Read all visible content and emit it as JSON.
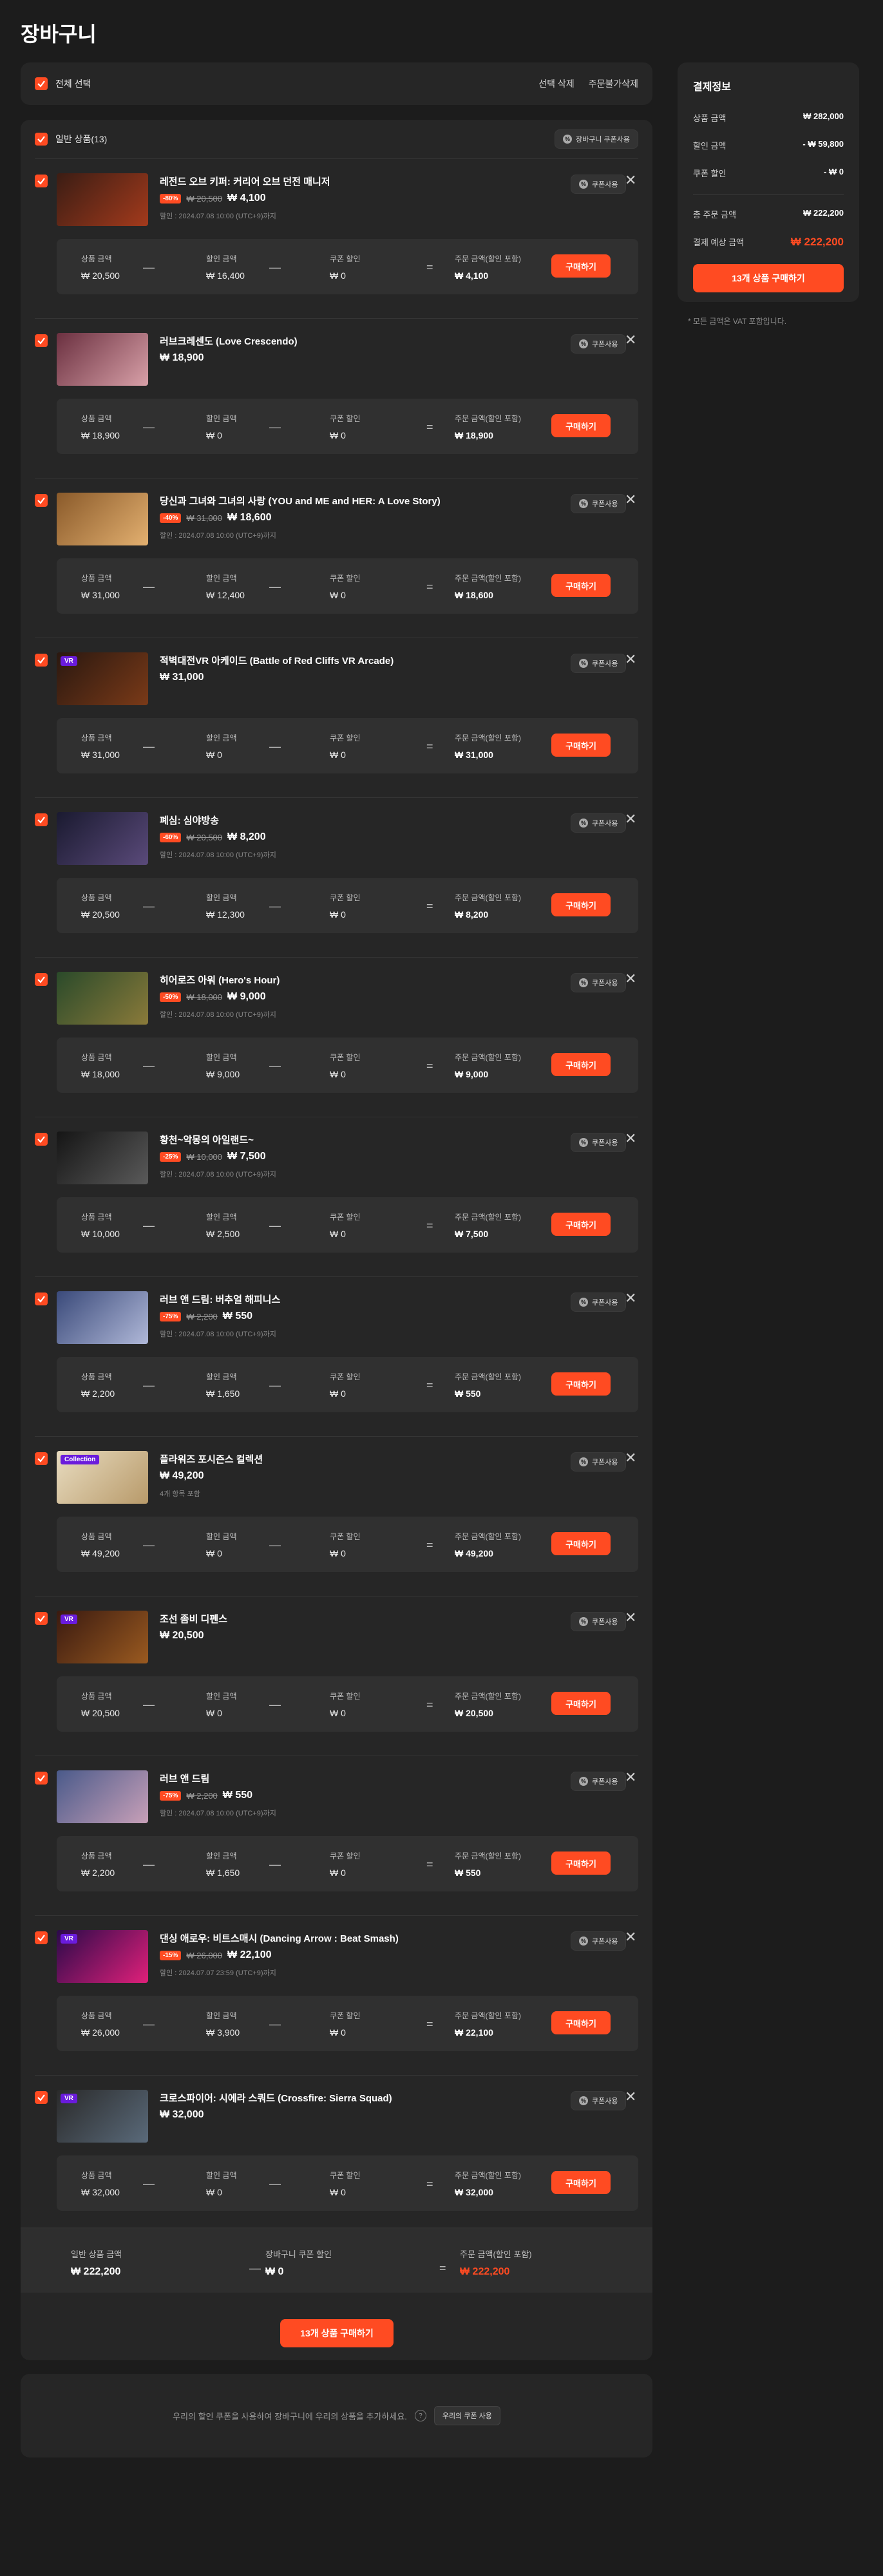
{
  "page": {
    "title": "장바구니"
  },
  "select_bar": {
    "select_all": "전체 선택",
    "delete_selected": "선택 삭제",
    "delete_unavailable": "주문불가삭제"
  },
  "cart_head": {
    "label": "일반 상품(13)",
    "coupon_button": "장바구니 쿠폰사용"
  },
  "calc_labels": {
    "product": "상품 금액",
    "discount": "할인 금액",
    "coupon": "쿠폰 할인",
    "order": "주문 금액(할인 포함)"
  },
  "item_buttons": {
    "coupon": "쿠폰사용",
    "buy": "구매하기"
  },
  "items": [
    {
      "title": "레전드 오브 키퍼: 커리어 오브 던전 매니저",
      "badge": "",
      "discount": "-80%",
      "original": "₩ 20,500",
      "price": "₩ 4,100",
      "period": "할인 : 2024.07.08 10:00 (UTC+9)까지",
      "note": "",
      "product": "₩ 20,500",
      "disc_amount": "₩ 16,400",
      "coupon": "₩ 0",
      "order": "₩ 4,100",
      "colors": [
        "#3b1d14",
        "#a33a1c"
      ]
    },
    {
      "title": "러브크레센도 (Love Crescendo)",
      "badge": "",
      "discount": "",
      "original": "",
      "price": "₩ 18,900",
      "period": "",
      "note": "",
      "product": "₩ 18,900",
      "disc_amount": "₩ 0",
      "coupon": "₩ 0",
      "order": "₩ 18,900",
      "colors": [
        "#6b3040",
        "#d8a0a8"
      ]
    },
    {
      "title": "당신과 그녀와 그녀의 사랑 (YOU and ME and HER: A Love Story)",
      "badge": "",
      "discount": "-40%",
      "original": "₩ 31,000",
      "price": "₩ 18,600",
      "period": "할인 : 2024.07.08 10:00 (UTC+9)까지",
      "note": "",
      "product": "₩ 31,000",
      "disc_amount": "₩ 12,400",
      "coupon": "₩ 0",
      "order": "₩ 18,600",
      "colors": [
        "#8a5a2a",
        "#e3b070"
      ]
    },
    {
      "title": "적벽대전VR 아케이드 (Battle of Red Cliffs VR Arcade)",
      "badge": "VR",
      "discount": "",
      "original": "",
      "price": "₩ 31,000",
      "period": "",
      "note": "",
      "product": "₩ 31,000",
      "disc_amount": "₩ 0",
      "coupon": "₩ 0",
      "order": "₩ 31,000",
      "colors": [
        "#2a1810",
        "#7a3a18"
      ]
    },
    {
      "title": "폐심: 심야방송",
      "badge": "",
      "discount": "-60%",
      "original": "₩ 20,500",
      "price": "₩ 8,200",
      "period": "할인 : 2024.07.08 10:00 (UTC+9)까지",
      "note": "",
      "product": "₩ 20,500",
      "disc_amount": "₩ 12,300",
      "coupon": "₩ 0",
      "order": "₩ 8,200",
      "colors": [
        "#1a1a30",
        "#5a4a7a"
      ]
    },
    {
      "title": "히어로즈 아워 (Hero's Hour)",
      "badge": "",
      "discount": "-50%",
      "original": "₩ 18,000",
      "price": "₩ 9,000",
      "period": "할인 : 2024.07.08 10:00 (UTC+9)까지",
      "note": "",
      "product": "₩ 18,000",
      "disc_amount": "₩ 9,000",
      "coupon": "₩ 0",
      "order": "₩ 9,000",
      "colors": [
        "#2a4a2a",
        "#8a7a3a"
      ]
    },
    {
      "title": "황천~악몽의 아일랜드~",
      "badge": "",
      "discount": "-25%",
      "original": "₩ 10,000",
      "price": "₩ 7,500",
      "period": "할인 : 2024.07.08 10:00 (UTC+9)까지",
      "note": "",
      "product": "₩ 10,000",
      "disc_amount": "₩ 2,500",
      "coupon": "₩ 0",
      "order": "₩ 7,500",
      "colors": [
        "#151515",
        "#5a5a5a"
      ]
    },
    {
      "title": "러브 앤 드림: 버추얼 해피니스",
      "badge": "",
      "discount": "-75%",
      "original": "₩ 2,200",
      "price": "₩ 550",
      "period": "할인 : 2024.07.08 10:00 (UTC+9)까지",
      "note": "",
      "product": "₩ 2,200",
      "disc_amount": "₩ 1,650",
      "coupon": "₩ 0",
      "order": "₩ 550",
      "colors": [
        "#3a4a7a",
        "#b0b8d8"
      ]
    },
    {
      "title": "플라워즈 포시즌스 컬렉션",
      "badge": "Collection",
      "discount": "",
      "original": "",
      "price": "₩ 49,200",
      "period": "",
      "note": "4개 항목 포함",
      "product": "₩ 49,200",
      "disc_amount": "₩ 0",
      "coupon": "₩ 0",
      "order": "₩ 49,200",
      "colors": [
        "#e8dcc0",
        "#b89a6a"
      ]
    },
    {
      "title": "조선 좀비 디펜스",
      "badge": "VR",
      "discount": "",
      "original": "",
      "price": "₩ 20,500",
      "period": "",
      "note": "",
      "product": "₩ 20,500",
      "disc_amount": "₩ 0",
      "coupon": "₩ 0",
      "order": "₩ 20,500",
      "colors": [
        "#3a1a10",
        "#9a5a20"
      ]
    },
    {
      "title": "러브 앤 드림",
      "badge": "",
      "discount": "-75%",
      "original": "₩ 2,200",
      "price": "₩ 550",
      "period": "할인 : 2024.07.08 10:00 (UTC+9)까지",
      "note": "",
      "product": "₩ 2,200",
      "disc_amount": "₩ 1,650",
      "coupon": "₩ 0",
      "order": "₩ 550",
      "colors": [
        "#4a5a8a",
        "#c8a0b8"
      ]
    },
    {
      "title": "댄싱 애로우: 비트스매시 (Dancing Arrow : Beat Smash)",
      "badge": "VR",
      "discount": "-15%",
      "original": "₩ 26,000",
      "price": "₩ 22,100",
      "period": "할인 : 2024.07.07 23:59 (UTC+9)까지",
      "note": "",
      "product": "₩ 26,000",
      "disc_amount": "₩ 3,900",
      "coupon": "₩ 0",
      "order": "₩ 22,100",
      "colors": [
        "#2a0a4a",
        "#e0207a"
      ]
    },
    {
      "title": "크로스파이어: 시에라 스쿼드 (Crossfire: Sierra Squad)",
      "badge": "VR",
      "discount": "",
      "original": "",
      "price": "₩ 32,000",
      "period": "",
      "note": "",
      "product": "₩ 32,000",
      "disc_amount": "₩ 0",
      "coupon": "₩ 0",
      "order": "₩ 32,000",
      "colors": [
        "#2a2a2a",
        "#5a6a7a"
      ]
    }
  ],
  "summary": {
    "product_label": "일반 상품 금액",
    "product_value": "₩ 222,200",
    "coupon_label": "장바구니 쿠폰 할인",
    "coupon_value": "₩ 0",
    "order_label": "주문 금액(할인 포함)",
    "order_value": "₩ 222,200",
    "buy_button": "13개 상품 구매하기"
  },
  "notice": {
    "text": "우리의 할인 쿠폰을 사용하여 장바구니에 우리의 상품을 추가하세요.",
    "help": "?",
    "button": "우리의 쿠폰 사용"
  },
  "payment": {
    "title": "결제정보",
    "product_label": "상품 금액",
    "product_value": "₩ 282,000",
    "discount_label": "할인 금액",
    "discount_value": "- ₩ 59,800",
    "coupon_label": "쿠폰 할인",
    "coupon_value": "- ₩ 0",
    "total_label": "총 주문 금액",
    "total_value": "₩ 222,200",
    "pay_label": "결제 예상 금액",
    "pay_value": "₩ 222,200",
    "buy_button": "13개 상품 구매하기",
    "vat_note": "* 모든 금액은 VAT 포함입니다."
  },
  "accent_color": "#ff4b22"
}
